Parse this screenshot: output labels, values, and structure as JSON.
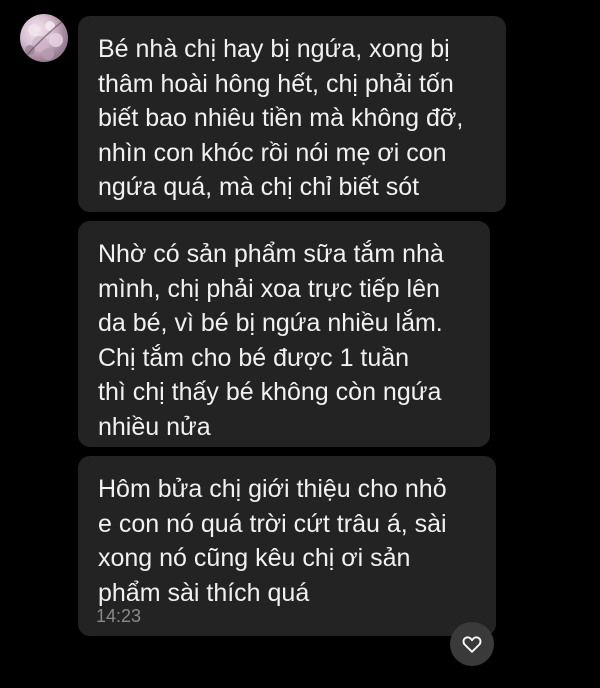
{
  "messages": [
    {
      "lines": [
        "Bé nhà chị hay bị ngứa, xong bị",
        "thâm hoài hông hết, chị phải tốn",
        "biết bao nhiêu tiền mà không đỡ,",
        "nhìn con khóc rồi nói mẹ ơi con",
        "ngứa quá, mà chị chỉ biết sót"
      ]
    },
    {
      "lines": [
        "Nhờ có sản phẩm sữa tắm nhà",
        "mình, chị phải xoa trực tiếp lên",
        "da bé, vì bé bị ngứa nhiều lắm.",
        "Chị tắm cho bé được 1 tuần",
        "thì chị thấy bé không còn ngứa",
        "nhiều nửa"
      ]
    },
    {
      "lines": [
        "Hôm bửa chị giới thiệu cho nhỏ",
        "e con nó quá trời cứt trâu á, sài",
        "xong nó cũng kêu chị ơi sản",
        "phẩm sài thích quá"
      ],
      "time": "14:23"
    }
  ],
  "icons": {
    "avatar": "avatar",
    "reaction": "heart-icon"
  },
  "colors": {
    "background": "#000000",
    "bubble": "#232323",
    "text": "#f1f1f1",
    "timestamp": "#8a8a8a",
    "reaction_button": "#3a3a3a"
  }
}
